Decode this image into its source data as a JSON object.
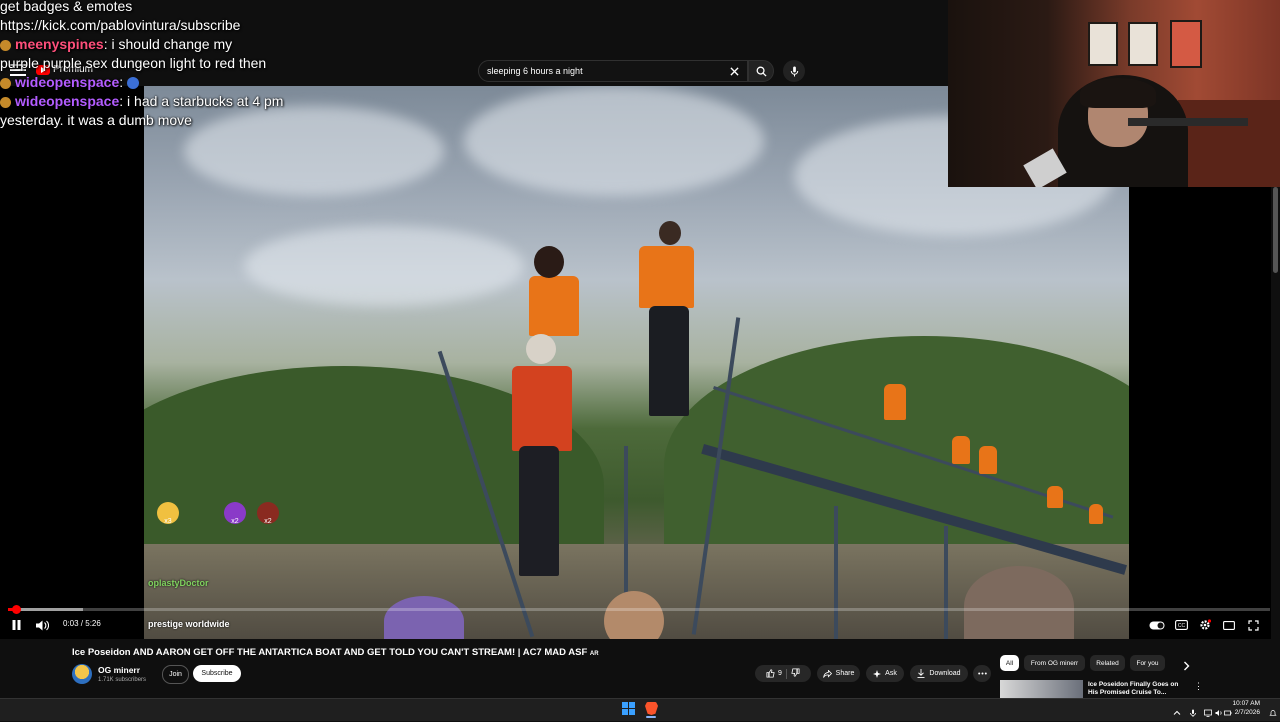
{
  "search": {
    "query": "sleeping 6 hours a night"
  },
  "brand": {
    "logo_text": "Premium"
  },
  "chat": [
    {
      "text": "get badges & emotes"
    },
    {
      "text": "https://kick.com/pablovintura/subscribe"
    },
    {
      "user": "meenyspines",
      "message": ": i should change my"
    },
    {
      "text": "purple purple sex dungeon light to red then"
    },
    {
      "user": "wideopenspace",
      "message": ":"
    },
    {
      "user": "wideopenspace",
      "message": ": i had a starbucks at 4 pm"
    },
    {
      "text": "yesterday. it was a dumb move"
    }
  ],
  "overlay": {
    "reaction_user": "oplastyDoctor",
    "caption": "prestige worldwide",
    "reactions": [
      "x3",
      "x2",
      "x2"
    ]
  },
  "player": {
    "time": "0:03 / 5:26",
    "progress_fraction": 0.005
  },
  "video": {
    "title": "Ice Poseidon AND AARON GET OFF THE ANTARTICA BOAT AND GET TOLD YOU CAN'T STREAM! | AC7 MAD ASF",
    "title_suffix": "AR",
    "channel": "OG minerr",
    "subscribers": "1.71K subscribers",
    "join_label": "Join",
    "subscribe_label": "Subscribe",
    "likes": "9",
    "share_label": "Share",
    "ask_label": "Ask",
    "download_label": "Download"
  },
  "recommendations": {
    "chips": [
      "All",
      "From OG minerr",
      "Related",
      "For you"
    ],
    "first_title": "Ice Poseidon Finally Goes on His Promised Cruise To..."
  },
  "taskbar": {
    "time": "10:07 AM",
    "date": "2/7/2026"
  },
  "colors": {
    "accent_red": "#ff0000",
    "chat_username": "#b35cff",
    "background": "#0f0f0f"
  }
}
